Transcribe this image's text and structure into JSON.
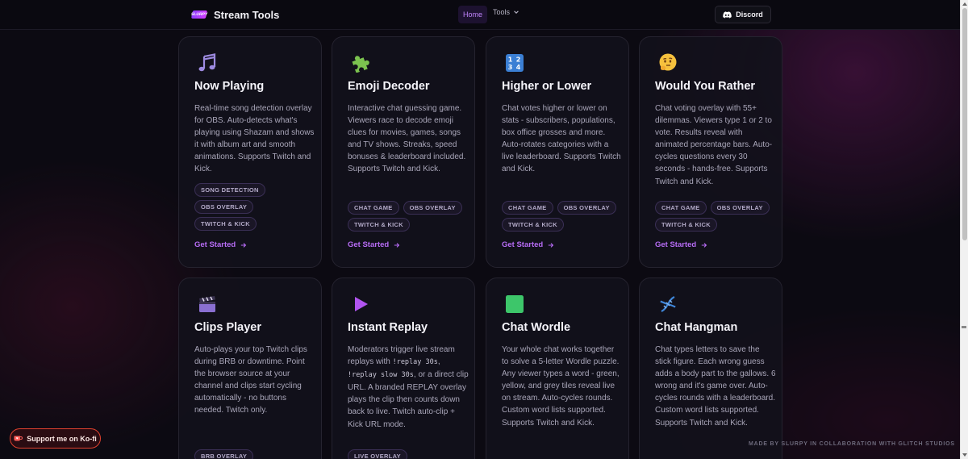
{
  "navbar": {
    "logo_text": "SLURPY",
    "brand": "Stream Tools",
    "home": "Home",
    "tools": "Tools",
    "discord": "Discord"
  },
  "colors": {
    "accent": "#b76cf5",
    "background": "#0c0a12",
    "card": "#12111b",
    "kofi_border": "#e0412f"
  },
  "cards": [
    {
      "icon": "music-notes-icon",
      "title": "Now Playing",
      "description": "Real-time song detection overlay for OBS. Auto-detects what's playing using Shazam and shows it with album art and smooth animations. Supports Twitch and Kick.",
      "tags": [
        "SONG DETECTION",
        "OBS OVERLAY",
        "TWITCH & KICK"
      ],
      "cta": "Get Started"
    },
    {
      "icon": "puzzle-piece-icon",
      "title": "Emoji Decoder",
      "description": "Interactive chat guessing game. Viewers race to decode emoji clues for movies, games, songs and TV shows. Streaks, speed bonuses & leaderboard included. Supports Twitch and Kick.",
      "tags": [
        "CHAT GAME",
        "OBS OVERLAY",
        "TWITCH & KICK"
      ],
      "cta": "Get Started"
    },
    {
      "icon": "numbers-icon",
      "icon_text": "1234",
      "title": "Higher or Lower",
      "description": "Chat votes higher or lower on stats - subscribers, populations, box office grosses and more. Auto-rotates categories with a live leaderboard. Supports Twitch and Kick.",
      "tags": [
        "CHAT GAME",
        "OBS OVERLAY",
        "TWITCH & KICK"
      ],
      "cta": "Get Started"
    },
    {
      "icon": "thinking-face-icon",
      "title": "Would You Rather",
      "description": "Chat voting overlay with 55+ dilemmas. Viewers type 1 or 2 to vote. Results reveal with animated percentage bars. Auto-cycles questions every 30 seconds - hands-free. Supports Twitch and Kick.",
      "tags": [
        "CHAT GAME",
        "OBS OVERLAY",
        "TWITCH & KICK"
      ],
      "cta": "Get Started"
    },
    {
      "icon": "clapperboard-icon",
      "title": "Clips Player",
      "description": "Auto-plays your top Twitch clips during BRB or downtime. Point the browser source at your channel and clips start cycling automatically - no buttons needed. Twitch only.",
      "tags": [
        "BRB OVERLAY"
      ]
    },
    {
      "icon": "play-icon",
      "title": "Instant Replay",
      "desc_parts": {
        "a": "Moderators trigger live stream replays with ",
        "code1": "!replay 30s",
        "b": ", ",
        "code2": "!replay slow 30s",
        "c": ", or a direct clip URL. A branded REPLAY overlay plays the clip then counts down back to live. Twitch auto-clip + Kick URL mode."
      },
      "tags": [
        "LIVE OVERLAY"
      ]
    },
    {
      "icon": "green-square-icon",
      "title": "Chat Wordle",
      "description": "Your whole chat works together to solve a 5-letter Wordle puzzle. Any viewer types a word - green, yellow, and grey tiles reveal live on stream. Auto-cycles rounds. Custom word lists supported. Supports Twitch and Kick."
    },
    {
      "icon": "dna-icon",
      "title": "Chat Hangman",
      "description": "Chat types letters to save the stick figure. Each wrong guess adds a body part to the gallows. 6 wrong and it's game over. Auto-cycles rounds with a leaderboard. Custom word lists supported. Supports Twitch and Kick."
    }
  ],
  "footer": {
    "kofi": "Support me on Ko-fi",
    "credit": "MADE BY SLURPY IN COLLABORATION WITH GLITCH STUDIOS"
  }
}
